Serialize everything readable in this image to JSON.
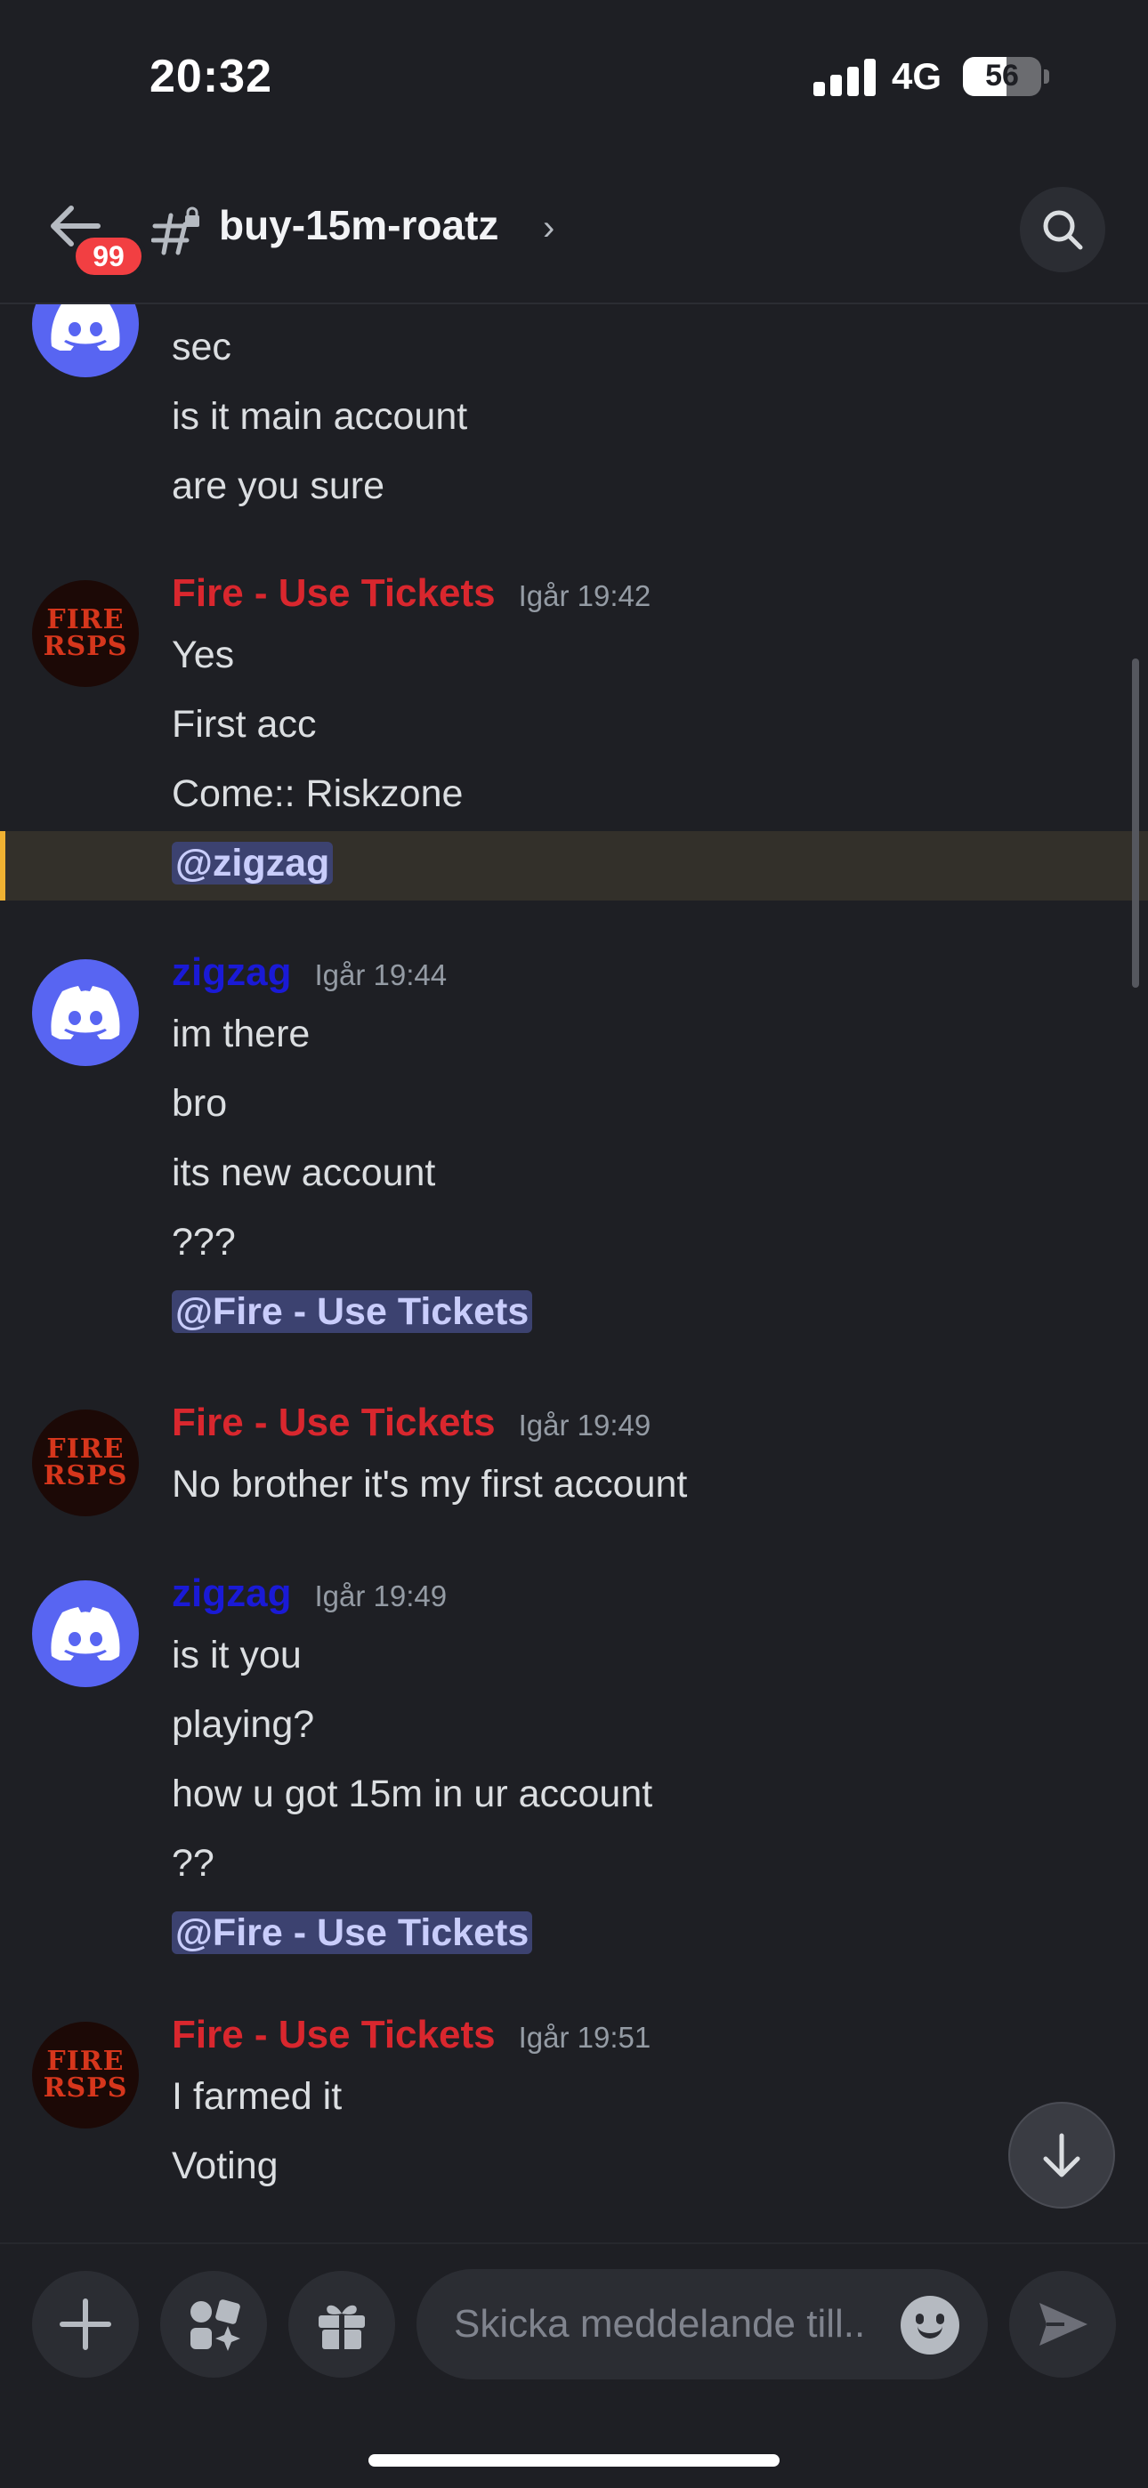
{
  "status_bar": {
    "time": "20:32",
    "network": "4G",
    "battery": "56",
    "battery_level": 0.56
  },
  "header": {
    "unread_badge": "99",
    "channel_name": "buy-15m-roatz",
    "chevron": "›"
  },
  "avatars": {
    "fire_line1": "FIRE",
    "fire_line2": "RSPS"
  },
  "messages": {
    "g0": {
      "lines": [
        "sec",
        "is it main account",
        "are you sure"
      ]
    },
    "g1": {
      "author": "Fire - Use Tickets",
      "time": "Igår 19:42",
      "lines": [
        "Yes",
        "First acc",
        "Come:: Riskzone"
      ],
      "mention": "@zigzag"
    },
    "g2": {
      "author": "zigzag",
      "time": "Igår 19:44",
      "lines": [
        "im there",
        "bro",
        "its new account",
        "???"
      ],
      "mention": "@Fire - Use Tickets"
    },
    "g3": {
      "author": "Fire - Use Tickets",
      "time": "Igår 19:49",
      "lines": [
        "No brother it's my first account"
      ]
    },
    "g4": {
      "author": "zigzag",
      "time": "Igår 19:49",
      "lines": [
        "is it you",
        "playing?",
        "how u got 15m in ur account",
        "??"
      ],
      "mention": "@Fire - Use Tickets"
    },
    "g5": {
      "author": "Fire - Use Tickets",
      "time": "Igår 19:51",
      "lines": [
        "I farmed it",
        "Voting"
      ]
    }
  },
  "composer": {
    "placeholder": "Skicka meddelande till.."
  },
  "colors": {
    "fire_author": "#d9272e",
    "zigzag_author": "#1a1ad6",
    "mention_bg": "#3c4270",
    "highlight_bar": "#f0b232",
    "discord_blurple": "#5865f2"
  },
  "icons": [
    "back-arrow-icon",
    "locked-channel-icon",
    "search-icon",
    "discord-logo-icon",
    "arrow-down-icon",
    "plus-icon",
    "apps-icon",
    "gift-icon",
    "emoji-icon",
    "send-icon"
  ]
}
